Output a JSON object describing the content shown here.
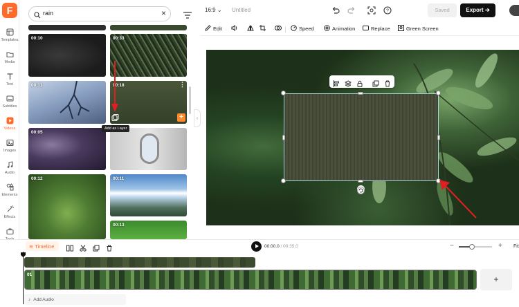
{
  "brand": {
    "logo_letter": "F",
    "accent": "#ff6b2b"
  },
  "rail": {
    "items": [
      {
        "label": "Templates",
        "icon": "templates-icon"
      },
      {
        "label": "Media",
        "icon": "folder-icon"
      },
      {
        "label": "Text",
        "icon": "text-icon"
      },
      {
        "label": "Subtitles",
        "icon": "subtitles-icon"
      },
      {
        "label": "Videos",
        "icon": "video-icon",
        "active": true
      },
      {
        "label": "Images",
        "icon": "image-icon"
      },
      {
        "label": "Audio",
        "icon": "music-icon"
      },
      {
        "label": "Elements",
        "icon": "elements-icon"
      },
      {
        "label": "Effects",
        "icon": "effects-icon"
      },
      {
        "label": "Tools",
        "icon": "toolbox-icon"
      }
    ]
  },
  "search": {
    "query": "rain",
    "clear_icon": "close-icon",
    "filter_icon": "filter-icon"
  },
  "videos": [
    {
      "duration": "00:10"
    },
    {
      "duration": "00:33"
    },
    {
      "duration": "00:11"
    },
    {
      "duration": "00:18"
    },
    {
      "duration": "00:05"
    },
    {
      "duration": ""
    },
    {
      "duration": "00:12"
    },
    {
      "duration": "00:11"
    },
    {
      "duration": "00:13"
    }
  ],
  "tooltip": "Add as Layer",
  "topbar": {
    "ratio": "16:9",
    "title": "Untitled",
    "saved_label": "Saved",
    "export_label": "Export"
  },
  "toolbar": {
    "items": [
      {
        "label": "Edit"
      },
      {
        "label": ""
      },
      {
        "label": ""
      },
      {
        "label": ""
      },
      {
        "label": ""
      },
      {
        "label": "Speed"
      },
      {
        "label": "Animation"
      },
      {
        "label": "Replace"
      },
      {
        "label": "Green Screen"
      }
    ]
  },
  "timeline": {
    "tab_label": "Timeline",
    "current_time": "00:00.0",
    "separator": " / ",
    "total_time": "00:35.0",
    "clip_index": "01",
    "add_clip_label": "+",
    "add_audio_label": "Add Audio",
    "zoom_level": 0.4,
    "fit_label": "Fit"
  }
}
